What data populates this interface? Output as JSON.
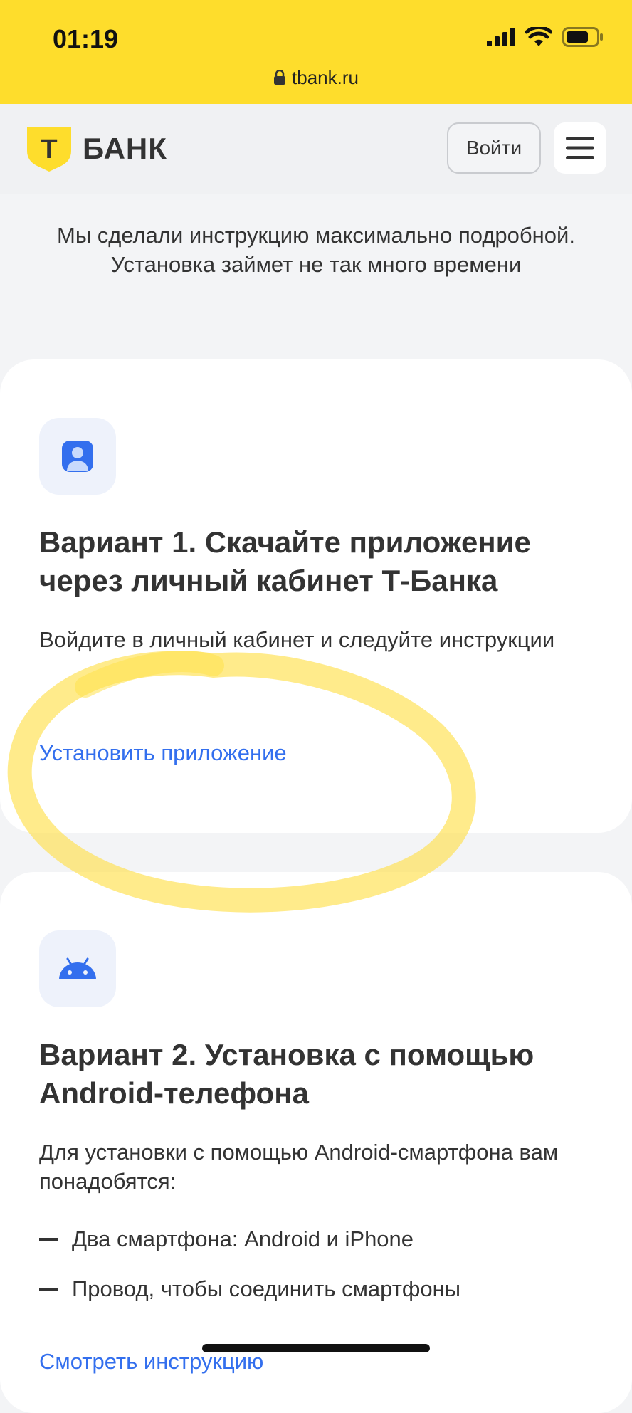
{
  "status_bar": {
    "time": "01:19",
    "url": "tbank.ru",
    "icons": [
      "signal-icon",
      "wifi-icon",
      "battery-icon"
    ]
  },
  "header": {
    "logo_letter": "Т",
    "logo_text": "БАНК",
    "login_label": "Войти",
    "menu_icon": "hamburger-icon"
  },
  "intro": "Мы сделали инструкцию максимально подробной. Установка займет не так много времени",
  "option1": {
    "icon": "user-profile-icon",
    "title": "Вариант 1. Скачайте приложение через личный кабинет Т-Банка",
    "text": "Войдите в личный кабинет и следуйте инструкции",
    "link": "Установить приложение"
  },
  "option2": {
    "icon": "android-icon",
    "title": "Вариант 2. Установка с помощью Android-телефона",
    "text": "Для установки с помощью Android-смартфона вам понадобятся:",
    "bullets": [
      "Два смартфона: Android и iPhone",
      "Провод, чтобы соединить смартфоны"
    ],
    "link": "Смотреть инструкцию"
  },
  "colors": {
    "brand_yellow": "#fedd2c",
    "link_blue": "#336fee",
    "highlight": "#ffe14d"
  }
}
